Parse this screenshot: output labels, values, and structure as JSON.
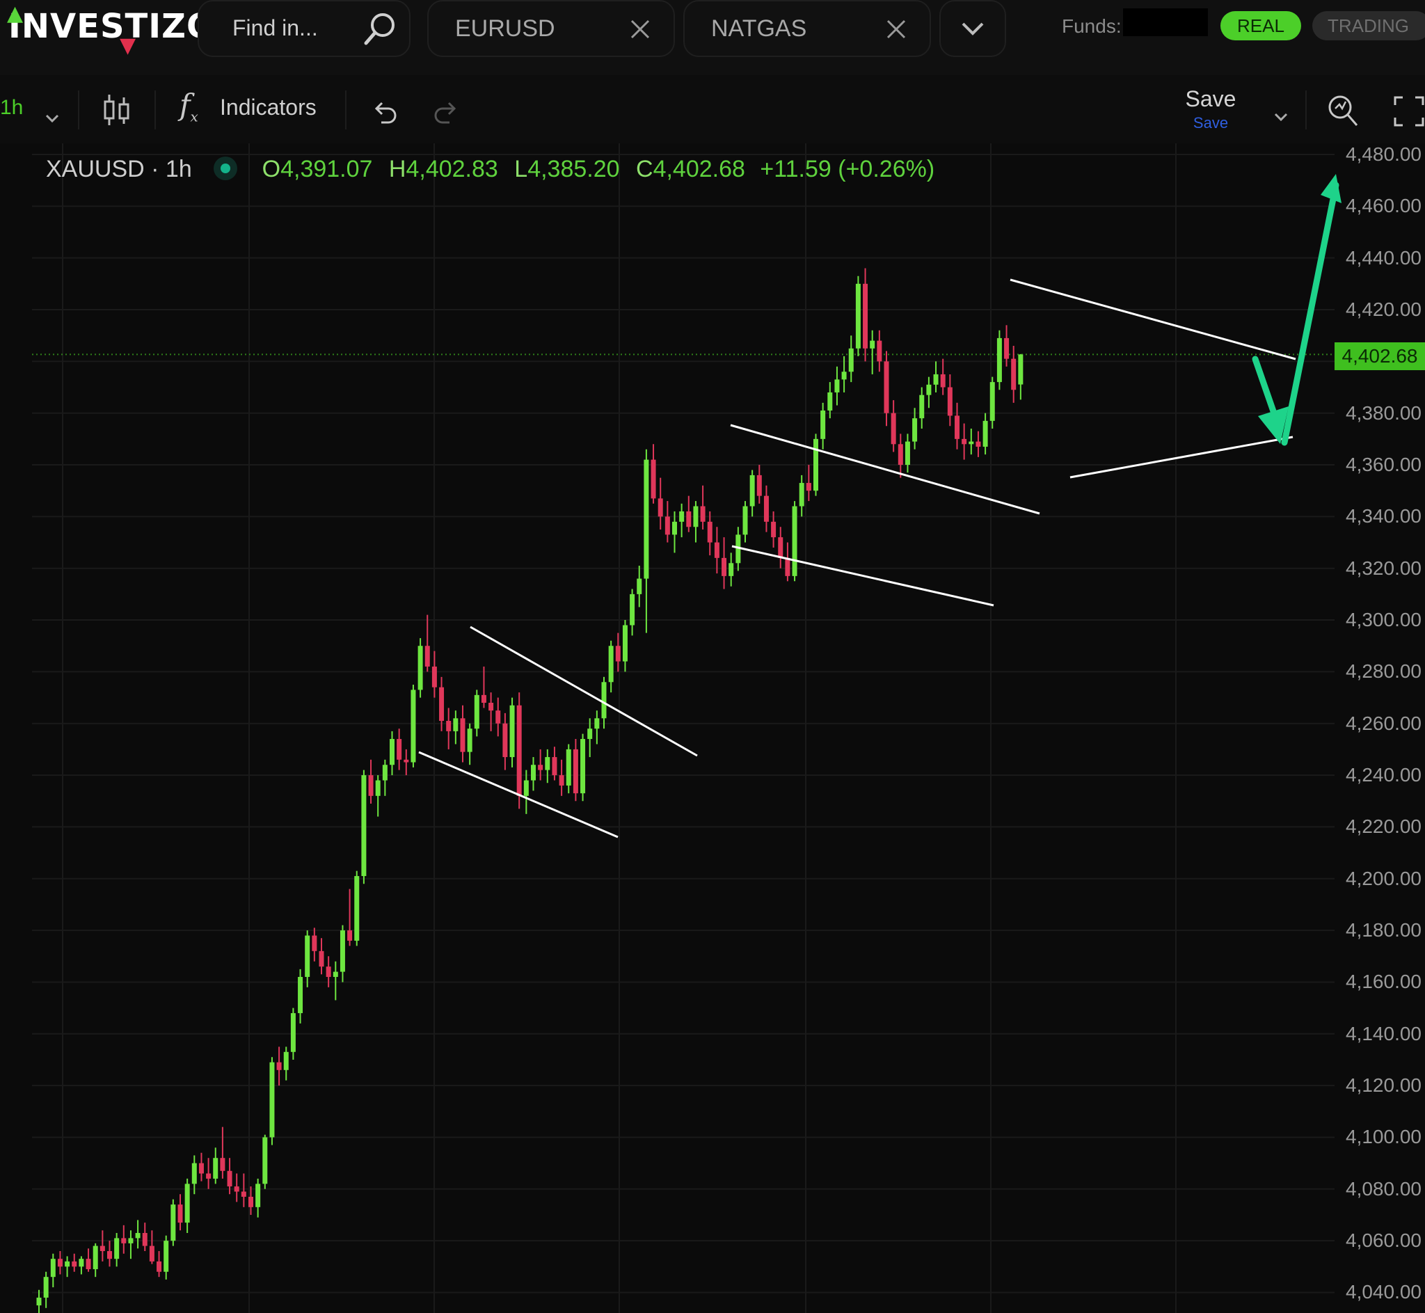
{
  "app": {
    "logo_text": "INVESTIZO"
  },
  "search": {
    "placeholder": "Find in..."
  },
  "tabs": [
    {
      "label": "EURUSD"
    },
    {
      "label": "NATGAS"
    }
  ],
  "funds": {
    "label": "Funds:"
  },
  "account": {
    "real_label": "REAL",
    "trading_label": "TRADING"
  },
  "toolbar": {
    "interval": "1h",
    "indicators_label": "Indicators",
    "save_label": "Save",
    "save_sub_label": "Save"
  },
  "legend": {
    "symbol": "XAUUSD · 1h",
    "open_key": "O",
    "open": "4,391.07",
    "high_key": "H",
    "high": "4,402.83",
    "low_key": "L",
    "low": "4,385.20",
    "close_key": "C",
    "close": "4,402.68",
    "change": "+11.59 (+0.26%)"
  },
  "price_axis": {
    "ticks": [
      "4,480.00",
      "4,460.00",
      "4,440.00",
      "4,420.00",
      "4,400.00",
      "4,380.00",
      "4,360.00",
      "4,340.00",
      "4,320.00",
      "4,300.00",
      "4,280.00",
      "4,260.00",
      "4,240.00",
      "4,220.00",
      "4,200.00",
      "4,180.00",
      "4,160.00",
      "4,140.00",
      "4,120.00",
      "4,100.00",
      "4,080.00",
      "4,060.00",
      "4,040.00"
    ],
    "last_price": "4,402.68"
  },
  "colors": {
    "up": "#6ee640",
    "down": "#e0375a",
    "accent": "#4ccf29",
    "arrow": "#1ed38a",
    "trendline": "#ffffff"
  },
  "chart_data": {
    "type": "candlestick",
    "symbol": "XAUUSD",
    "interval": "1h",
    "ylim": [
      4030,
      4485
    ],
    "price_ticks": [
      4040,
      4060,
      4080,
      4100,
      4120,
      4140,
      4160,
      4180,
      4200,
      4220,
      4240,
      4260,
      4280,
      4300,
      4320,
      4340,
      4360,
      4380,
      4400,
      4420,
      4440,
      4460,
      4480
    ],
    "last_price": 4402.68,
    "ohlc": [
      [
        4035,
        4041,
        4030,
        4038
      ],
      [
        4038,
        4048,
        4034,
        4046
      ],
      [
        4046,
        4055,
        4042,
        4053
      ],
      [
        4053,
        4056,
        4047,
        4050
      ],
      [
        4050,
        4054,
        4046,
        4052
      ],
      [
        4052,
        4055,
        4048,
        4050
      ],
      [
        4050,
        4054,
        4047,
        4053
      ],
      [
        4053,
        4057,
        4048,
        4049
      ],
      [
        4049,
        4059,
        4046,
        4058
      ],
      [
        4058,
        4064,
        4052,
        4056
      ],
      [
        4056,
        4060,
        4050,
        4053
      ],
      [
        4053,
        4063,
        4050,
        4061
      ],
      [
        4061,
        4066,
        4055,
        4059
      ],
      [
        4059,
        4064,
        4053,
        4061
      ],
      [
        4061,
        4068,
        4057,
        4063
      ],
      [
        4063,
        4067,
        4056,
        4058
      ],
      [
        4058,
        4064,
        4051,
        4052
      ],
      [
        4052,
        4056,
        4046,
        4048
      ],
      [
        4048,
        4062,
        4045,
        4060
      ],
      [
        4060,
        4076,
        4058,
        4074
      ],
      [
        4074,
        4078,
        4064,
        4067
      ],
      [
        4067,
        4084,
        4063,
        4082
      ],
      [
        4082,
        4093,
        4078,
        4090
      ],
      [
        4090,
        4094,
        4083,
        4086
      ],
      [
        4086,
        4092,
        4080,
        4084
      ],
      [
        4084,
        4096,
        4082,
        4092
      ],
      [
        4092,
        4104,
        4084,
        4087
      ],
      [
        4087,
        4092,
        4078,
        4081
      ],
      [
        4081,
        4086,
        4075,
        4079
      ],
      [
        4079,
        4086,
        4073,
        4077
      ],
      [
        4077,
        4081,
        4070,
        4073
      ],
      [
        4073,
        4084,
        4069,
        4082
      ],
      [
        4082,
        4101,
        4080,
        4100
      ],
      [
        4100,
        4131,
        4097,
        4129
      ],
      [
        4129,
        4135,
        4120,
        4126
      ],
      [
        4126,
        4135,
        4122,
        4133
      ],
      [
        4133,
        4150,
        4130,
        4148
      ],
      [
        4148,
        4165,
        4144,
        4162
      ],
      [
        4162,
        4180,
        4158,
        4178
      ],
      [
        4178,
        4181,
        4168,
        4172
      ],
      [
        4172,
        4177,
        4163,
        4166
      ],
      [
        4166,
        4170,
        4158,
        4162
      ],
      [
        4162,
        4168,
        4153,
        4164
      ],
      [
        4164,
        4182,
        4160,
        4180
      ],
      [
        4180,
        4196,
        4174,
        4176
      ],
      [
        4176,
        4203,
        4174,
        4201
      ],
      [
        4201,
        4242,
        4198,
        4240
      ],
      [
        4240,
        4246,
        4229,
        4232
      ],
      [
        4232,
        4240,
        4224,
        4238
      ],
      [
        4238,
        4246,
        4232,
        4244
      ],
      [
        4244,
        4257,
        4240,
        4254
      ],
      [
        4254,
        4258,
        4242,
        4246
      ],
      [
        4246,
        4250,
        4240,
        4245
      ],
      [
        4245,
        4275,
        4243,
        4273
      ],
      [
        4273,
        4293,
        4270,
        4290
      ],
      [
        4290,
        4302,
        4280,
        4282
      ],
      [
        4282,
        4288,
        4270,
        4274
      ],
      [
        4274,
        4278,
        4257,
        4261
      ],
      [
        4261,
        4266,
        4250,
        4257
      ],
      [
        4257,
        4265,
        4252,
        4262
      ],
      [
        4262,
        4267,
        4245,
        4249
      ],
      [
        4249,
        4260,
        4244,
        4258
      ],
      [
        4258,
        4273,
        4255,
        4271
      ],
      [
        4271,
        4282,
        4266,
        4268
      ],
      [
        4268,
        4272,
        4257,
        4265
      ],
      [
        4265,
        4270,
        4255,
        4260
      ],
      [
        4260,
        4264,
        4242,
        4247
      ],
      [
        4247,
        4270,
        4243,
        4267
      ],
      [
        4267,
        4272,
        4227,
        4232
      ],
      [
        4232,
        4242,
        4225,
        4238
      ],
      [
        4238,
        4247,
        4234,
        4244
      ],
      [
        4244,
        4250,
        4238,
        4242
      ],
      [
        4242,
        4250,
        4237,
        4247
      ],
      [
        4247,
        4251,
        4238,
        4240
      ],
      [
        4240,
        4246,
        4232,
        4236
      ],
      [
        4236,
        4252,
        4233,
        4250
      ],
      [
        4250,
        4254,
        4230,
        4233
      ],
      [
        4233,
        4256,
        4230,
        4254
      ],
      [
        4254,
        4262,
        4247,
        4258
      ],
      [
        4258,
        4265,
        4252,
        4262
      ],
      [
        4262,
        4278,
        4258,
        4276
      ],
      [
        4276,
        4292,
        4272,
        4290
      ],
      [
        4290,
        4295,
        4280,
        4284
      ],
      [
        4284,
        4300,
        4280,
        4298
      ],
      [
        4298,
        4312,
        4294,
        4310
      ],
      [
        4310,
        4321,
        4305,
        4316
      ],
      [
        4316,
        4366,
        4295,
        4362
      ],
      [
        4362,
        4368,
        4345,
        4347
      ],
      [
        4347,
        4355,
        4335,
        4340
      ],
      [
        4340,
        4346,
        4330,
        4333
      ],
      [
        4333,
        4342,
        4326,
        4338
      ],
      [
        4338,
        4345,
        4332,
        4342
      ],
      [
        4342,
        4348,
        4334,
        4336
      ],
      [
        4336,
        4346,
        4330,
        4344
      ],
      [
        4344,
        4352,
        4335,
        4338
      ],
      [
        4338,
        4342,
        4325,
        4330
      ],
      [
        4330,
        4336,
        4318,
        4324
      ],
      [
        4324,
        4332,
        4312,
        4317
      ],
      [
        4317,
        4326,
        4313,
        4322
      ],
      [
        4322,
        4336,
        4319,
        4333
      ],
      [
        4333,
        4346,
        4330,
        4344
      ],
      [
        4344,
        4358,
        4340,
        4356
      ],
      [
        4356,
        4360,
        4345,
        4348
      ],
      [
        4348,
        4352,
        4334,
        4338
      ],
      [
        4338,
        4342,
        4328,
        4332
      ],
      [
        4332,
        4336,
        4320,
        4324
      ],
      [
        4324,
        4330,
        4315,
        4317
      ],
      [
        4317,
        4346,
        4315,
        4344
      ],
      [
        4344,
        4356,
        4340,
        4353
      ],
      [
        4353,
        4360,
        4346,
        4350
      ],
      [
        4350,
        4372,
        4348,
        4370
      ],
      [
        4370,
        4384,
        4366,
        4381
      ],
      [
        4381,
        4392,
        4378,
        4388
      ],
      [
        4388,
        4398,
        4383,
        4393
      ],
      [
        4393,
        4402,
        4388,
        4396
      ],
      [
        4396,
        4410,
        4392,
        4405
      ],
      [
        4405,
        4433,
        4402,
        4430
      ],
      [
        4430,
        4436,
        4400,
        4405
      ],
      [
        4405,
        4412,
        4395,
        4408
      ],
      [
        4408,
        4412,
        4396,
        4400
      ],
      [
        4400,
        4404,
        4375,
        4380
      ],
      [
        4380,
        4385,
        4365,
        4368
      ],
      [
        4368,
        4372,
        4355,
        4360
      ],
      [
        4360,
        4372,
        4357,
        4369
      ],
      [
        4369,
        4382,
        4366,
        4378
      ],
      [
        4378,
        4390,
        4374,
        4387
      ],
      [
        4387,
        4394,
        4382,
        4391
      ],
      [
        4391,
        4400,
        4388,
        4395
      ],
      [
        4395,
        4401,
        4387,
        4390
      ],
      [
        4390,
        4395,
        4375,
        4379
      ],
      [
        4379,
        4384,
        4366,
        4370
      ],
      [
        4370,
        4376,
        4362,
        4368
      ],
      [
        4368,
        4374,
        4364,
        4369
      ],
      [
        4369,
        4373,
        4363,
        4367
      ],
      [
        4367,
        4380,
        4364,
        4377
      ],
      [
        4377,
        4394,
        4374,
        4392
      ],
      [
        4392,
        4412,
        4389,
        4409
      ],
      [
        4409,
        4414,
        4398,
        4401
      ],
      [
        4401,
        4406,
        4384,
        4389
      ],
      [
        4391.07,
        4402.83,
        4385.2,
        4402.68
      ]
    ],
    "trendlines": [
      {
        "points": [
          [
            4253.5,
            4297
          ],
          [
            4263,
            4262.5
          ]
        ]
      },
      {
        "points": [
          [
            4245.5,
            4248
          ],
          [
            4258,
            4215.5
          ]
        ]
      },
      {
        "points": [
          [
            4273,
            4366
          ],
          [
            4288.5,
            4346.5
          ]
        ]
      },
      {
        "points": [
          [
            4273,
            4326
          ],
          [
            4287,
            4310
          ]
        ]
      },
      {
        "points": [
          [
            4305,
            4426
          ],
          [
            4320,
            4396
          ]
        ]
      },
      {
        "points": [
          [
            4308.5,
            4354
          ],
          [
            4320,
            4371
          ]
        ]
      }
    ],
    "projection_arrows": [
      {
        "direction": "down",
        "from": [
          4318.5,
          4394
        ],
        "to": [
          4320.5,
          4368
        ]
      },
      {
        "direction": "up",
        "from": [
          4320.5,
          4368
        ],
        "to": [
          4323.5,
          4458
        ]
      }
    ]
  }
}
